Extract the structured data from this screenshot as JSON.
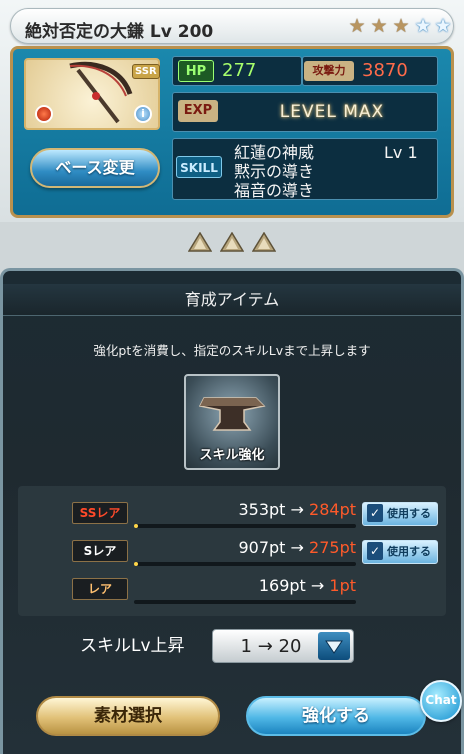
{
  "weapon": {
    "name": "絶対否定の大鎌 Lv 200",
    "rarity": "SSR",
    "stars": [
      {
        "icon": "uncap-star-icon",
        "state": "gold"
      },
      {
        "icon": "uncap-star-icon",
        "state": "gold"
      },
      {
        "icon": "uncap-star-icon",
        "state": "gold"
      },
      {
        "icon": "uncap-star-icon",
        "state": "blue"
      },
      {
        "icon": "uncap-star-icon",
        "state": "blue"
      }
    ],
    "element_icon": "fire-element-icon",
    "info_icon": "info-icon",
    "base_change_label": "ベース変更"
  },
  "stats": {
    "hp_label": "HP",
    "hp_value": "277",
    "atk_label": "攻撃力",
    "atk_value": "3870",
    "exp_label": "EXP",
    "exp_status": "LEVEL MAX"
  },
  "skills": {
    "label": "SKILL",
    "names": [
      "紅蓮の神威",
      "黙示の導き",
      "福音の導き"
    ],
    "level": "Lv 1"
  },
  "ascension_marks": 3,
  "enhance": {
    "title": "育成アイテム",
    "description": "強化ptを消費し、指定のスキルLvまで上昇します",
    "item_label": "スキル強化",
    "item_icon": "anvil-icon",
    "rows": [
      {
        "tag": "SSレア",
        "tag_color": "#ff4a2a",
        "current": "353pt",
        "arrow": "→",
        "after": "284pt",
        "fill": 0.02,
        "use_label": "使用する"
      },
      {
        "tag": "Sレア",
        "tag_color": "#ffffff",
        "current": "907pt",
        "arrow": "→",
        "after": "275pt",
        "fill": 0.02,
        "use_label": "使用する"
      },
      {
        "tag": "レア",
        "tag_color": "#ffc070",
        "current": "169pt",
        "arrow": "→",
        "after": "1pt",
        "fill": 0.0,
        "use_label": null
      }
    ],
    "skill_lv_label": "スキルLv上昇",
    "skill_lv_value": "1 → 20",
    "material_button": "素材選択",
    "enhance_button": "強化する",
    "chat_label": "Chat"
  }
}
